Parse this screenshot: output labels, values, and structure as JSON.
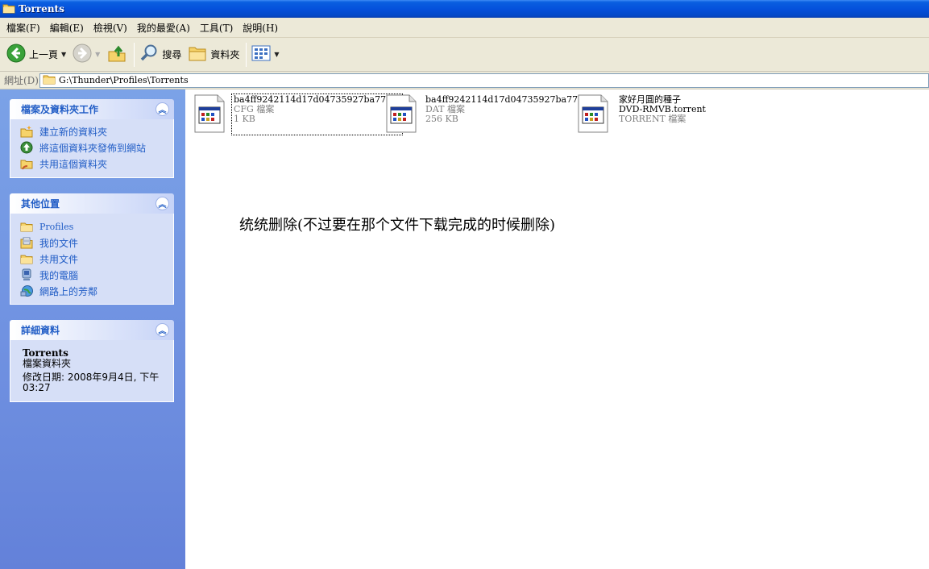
{
  "window": {
    "title": "Torrents"
  },
  "menu": [
    "檔案(F)",
    "編輯(E)",
    "檢視(V)",
    "我的最愛(A)",
    "工具(T)",
    "說明(H)"
  ],
  "toolbar": {
    "back_label": "上一頁",
    "search_label": "搜尋",
    "folders_label": "資料夾"
  },
  "address": {
    "label": "網址(D)",
    "path": "G:\\Thunder\\Profiles\\Torrents"
  },
  "tasks_panel": {
    "title": "檔案及資料夾工作",
    "items": [
      {
        "label": "建立新的資料夾",
        "icon": "new-folder-icon"
      },
      {
        "label": "將這個資料夾發佈到網站",
        "icon": "publish-web-icon"
      },
      {
        "label": "共用這個資料夾",
        "icon": "share-folder-icon"
      }
    ]
  },
  "places_panel": {
    "title": "其他位置",
    "items": [
      {
        "label": "Profiles",
        "icon": "folder-icon"
      },
      {
        "label": "我的文件",
        "icon": "my-documents-icon"
      },
      {
        "label": "共用文件",
        "icon": "folder-icon"
      },
      {
        "label": "我的電腦",
        "icon": "my-computer-icon"
      },
      {
        "label": "網路上的芳鄰",
        "icon": "network-icon"
      }
    ]
  },
  "details_panel": {
    "title": "詳細資料",
    "name": "Torrents",
    "type": "檔案資料夾",
    "modified": "修改日期: 2008年9月4日, 下午",
    "modified2": "03:27"
  },
  "files": [
    {
      "name": "ba4ff9242114d17d04735927ba775...",
      "type": "CFG 檔案",
      "size": "1 KB"
    },
    {
      "name": "ba4ff9242114d17d04735927ba775...",
      "type": "DAT 檔案",
      "size": "256 KB"
    },
    {
      "name": "家好月圓的種子",
      "type": "DVD-RMVB.torrent",
      "size": "TORRENT 檔案"
    }
  ],
  "note": "统统删除(不过要在那个文件下载完成的时候删除)",
  "colors": {
    "titlebar": "#0551dc",
    "link": "#215dc6",
    "sidebar": "#7ba2e7"
  }
}
